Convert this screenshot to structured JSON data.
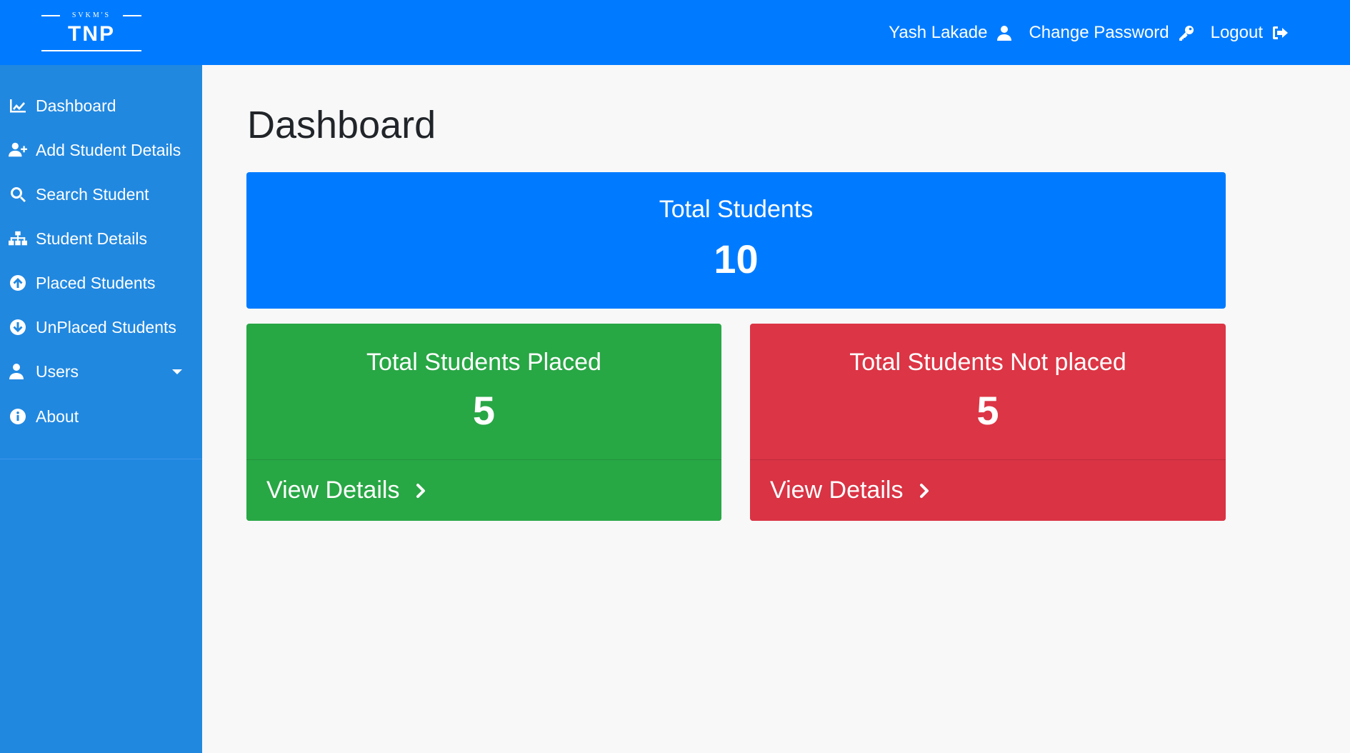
{
  "brand": {
    "small": "SVKM'S",
    "main": "TNP"
  },
  "topnav": {
    "user_name": "Yash Lakade",
    "change_password": "Change Password",
    "logout": "Logout"
  },
  "sidebar": {
    "items": [
      {
        "label": "Dashboard",
        "icon": "chart-line-icon"
      },
      {
        "label": "Add Student Details",
        "icon": "user-plus-icon"
      },
      {
        "label": "Search Student",
        "icon": "search-icon"
      },
      {
        "label": "Student Details",
        "icon": "sitemap-icon"
      },
      {
        "label": "Placed Students",
        "icon": "arrow-circle-up-icon"
      },
      {
        "label": "UnPlaced Students",
        "icon": "arrow-circle-down-icon"
      },
      {
        "label": "Users",
        "icon": "user-icon",
        "has_dropdown": true
      },
      {
        "label": "About",
        "icon": "info-circle-icon"
      }
    ]
  },
  "main": {
    "title": "Dashboard",
    "total_card": {
      "title": "Total Students",
      "count": "10",
      "color": "#007bff"
    },
    "placed_card": {
      "title": "Total Students Placed",
      "count": "5",
      "link": "View Details",
      "color": "#28a745"
    },
    "not_placed_card": {
      "title": "Total Students Not placed",
      "count": "5",
      "link": "View Details",
      "color": "#dc3545"
    }
  },
  "colors": {
    "topbar": "#007bff",
    "sidebar": "#2188e0",
    "background": "#f8f8f8"
  }
}
